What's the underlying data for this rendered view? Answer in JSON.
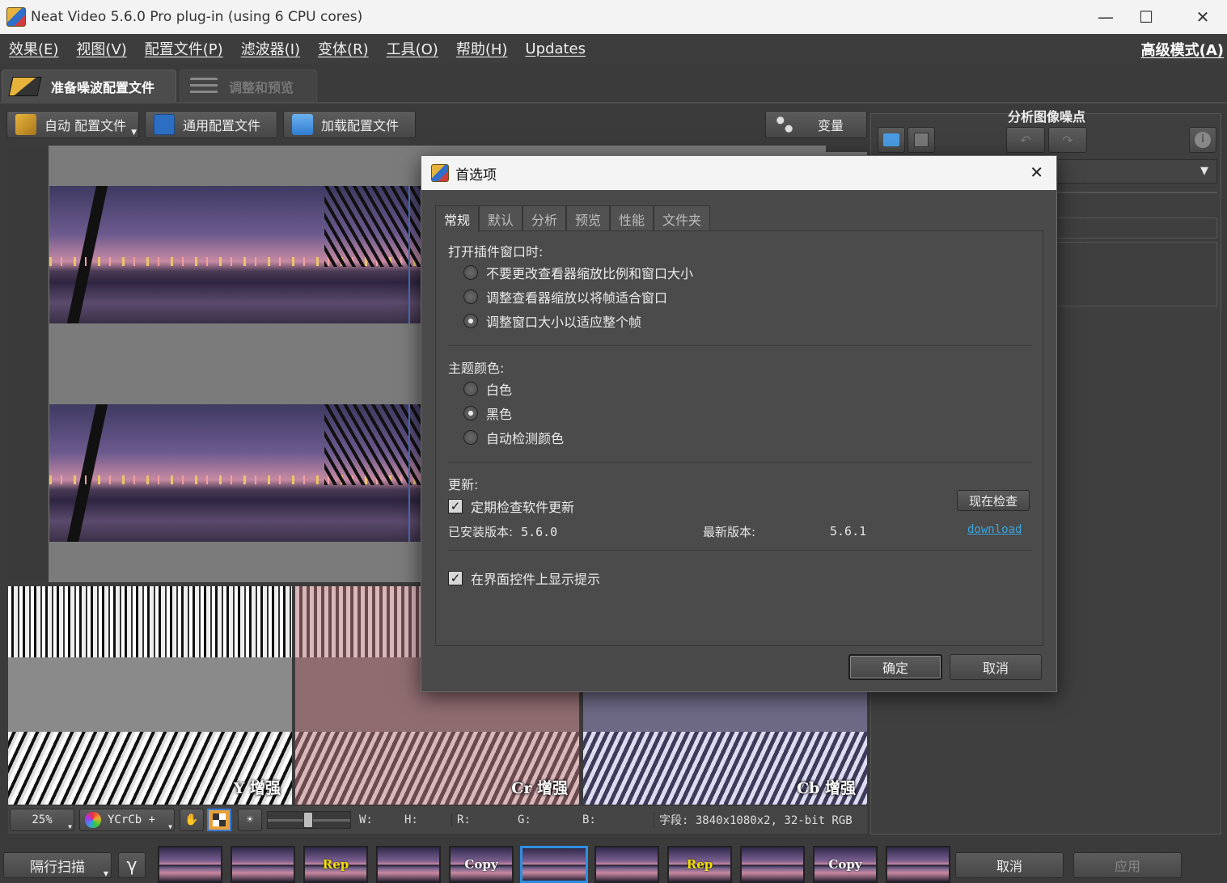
{
  "window": {
    "title": "Neat Video 5.6.0 Pro plug-in (using 6 CPU cores)",
    "minimize": "—",
    "maximize": "☐",
    "close": "✕"
  },
  "menu": {
    "items": [
      "效果(E)",
      "视图(V)",
      "配置文件(P)",
      "滤波器(I)",
      "变体(R)",
      "工具(O)",
      "帮助(H)",
      "Updates"
    ],
    "advanced_mode": "高级模式(A)"
  },
  "tabs": {
    "prepare": "准备噪波配置文件",
    "adjust": "调整和预览"
  },
  "toolbar": {
    "auto_profile": "自动 配置文件",
    "generic_profile": "通用配置文件",
    "load_profile": "加载配置文件",
    "variants": "变量"
  },
  "right_pane": {
    "title": "分析图像噪点"
  },
  "panels": {
    "y": "Y 增强",
    "cr": "Cr 增强",
    "cb": "Cb 增强"
  },
  "status": {
    "zoom": "25%",
    "colorspace": "YCrCb +",
    "w": "W:",
    "h": "H:",
    "r": "R:",
    "g": "G:",
    "b": "B:",
    "field": "字段: 3840x1080x2, 32-bit RGB"
  },
  "bottombar": {
    "scan": "隔行扫描",
    "gamma": "γ",
    "thumbs": [
      "",
      "",
      "Rep",
      "",
      "Copy",
      "",
      "",
      "Rep",
      "",
      "Copy",
      ""
    ],
    "cancel": "取消",
    "apply": "应用"
  },
  "dialog": {
    "title": "首选项",
    "close": "✕",
    "tabs": [
      "常规",
      "默认",
      "分析",
      "预览",
      "性能",
      "文件夹"
    ],
    "open_section": "打开插件窗口时:",
    "open_options": [
      "不要更改查看器缩放比例和窗口大小",
      "调整查看器缩放以将帧适合窗口",
      "调整窗口大小以适应整个帧"
    ],
    "open_selected": 2,
    "theme_section": "主题颜色:",
    "theme_options": [
      "白色",
      "黑色",
      "自动检测颜色"
    ],
    "theme_selected": 1,
    "update_section": "更新:",
    "check_updates": "定期检查软件更新",
    "check_now": "现在检查",
    "installed_label": "已安装版本:",
    "installed_version": "5.6.0",
    "latest_label": "最新版本:",
    "latest_version": "5.6.1",
    "download": "download",
    "show_tips": "在界面控件上显示提示",
    "ok": "确定",
    "cancel": "取消",
    "accent": "#3aa6e0"
  }
}
